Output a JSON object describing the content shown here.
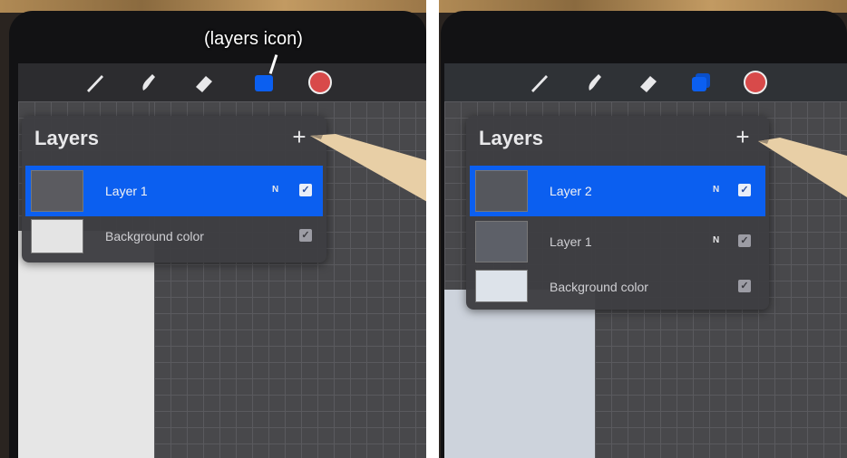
{
  "annotation": {
    "text": "(layers icon)"
  },
  "toolbar": {
    "tools": [
      "brush-icon",
      "smudge-icon",
      "eraser-icon",
      "layers-icon"
    ],
    "accent": "#0b5ff0",
    "color_swatch": "#d84a4a"
  },
  "before": {
    "panel_title": "Layers",
    "add_label": "+",
    "layers": [
      {
        "name": "Layer 1",
        "blend": "N",
        "visible": true,
        "selected": true
      },
      {
        "name": "Background color",
        "blend": "",
        "visible": true,
        "selected": false
      }
    ]
  },
  "after": {
    "panel_title": "Layers",
    "add_label": "+",
    "layers": [
      {
        "name": "Layer 2",
        "blend": "N",
        "visible": true,
        "selected": true
      },
      {
        "name": "Layer 1",
        "blend": "N",
        "visible": true,
        "selected": false
      },
      {
        "name": "Background color",
        "blend": "",
        "visible": true,
        "selected": false
      }
    ]
  }
}
